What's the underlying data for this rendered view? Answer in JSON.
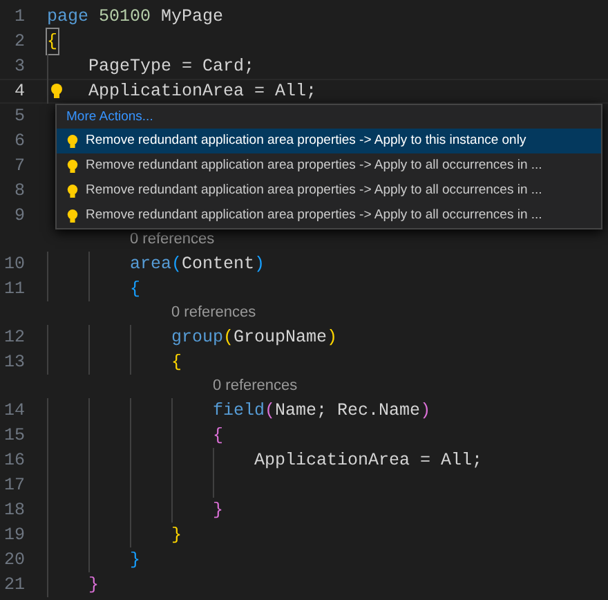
{
  "editor": {
    "lines": [
      {
        "kind": "code",
        "number": "1",
        "tokens": [
          {
            "kind": "keyword",
            "text": "page"
          },
          {
            "kind": "number",
            "text": " 50100"
          },
          {
            "kind": "plain",
            "text": " MyPage"
          }
        ]
      },
      {
        "kind": "code",
        "number": "2",
        "matched": true,
        "tokens": [
          {
            "kind": "bracket1",
            "text": "{"
          }
        ]
      },
      {
        "kind": "block",
        "children": [
          {
            "kind": "code",
            "number": "3",
            "tokens": [
              {
                "kind": "plain",
                "text": "PageType = Card;"
              }
            ]
          },
          {
            "kind": "code",
            "number": "4",
            "active": true,
            "lightbulb": true,
            "tokens": [
              {
                "kind": "plain",
                "text": "ApplicationArea = All;"
              }
            ]
          }
        ]
      },
      {
        "kind": "code",
        "number": "5"
      },
      {
        "kind": "code",
        "number": "6"
      },
      {
        "kind": "code",
        "number": "7"
      },
      {
        "kind": "code",
        "number": "8"
      },
      {
        "kind": "code",
        "number": "9"
      },
      {
        "kind": "block",
        "children": [
          {
            "kind": "block",
            "children": [
              {
                "kind": "codelens",
                "text": "0 references"
              },
              {
                "kind": "code",
                "number": "10",
                "tokens": [
                  {
                    "kind": "keyword",
                    "text": "area"
                  },
                  {
                    "kind": "bracket3",
                    "text": "("
                  },
                  {
                    "kind": "plain",
                    "text": "Content"
                  },
                  {
                    "kind": "bracket3",
                    "text": ")"
                  }
                ]
              },
              {
                "kind": "code",
                "number": "11",
                "tokens": [
                  {
                    "kind": "bracket3",
                    "text": "{"
                  }
                ]
              },
              {
                "kind": "block",
                "children": [
                  {
                    "kind": "codelens",
                    "text": "0 references"
                  },
                  {
                    "kind": "code",
                    "number": "12",
                    "tokens": [
                      {
                        "kind": "keyword",
                        "text": "group"
                      },
                      {
                        "kind": "bracket1",
                        "text": "("
                      },
                      {
                        "kind": "plain",
                        "text": "GroupName"
                      },
                      {
                        "kind": "bracket1",
                        "text": ")"
                      }
                    ]
                  },
                  {
                    "kind": "code",
                    "number": "13",
                    "tokens": [
                      {
                        "kind": "bracket1",
                        "text": "{"
                      }
                    ]
                  },
                  {
                    "kind": "block",
                    "children": [
                      {
                        "kind": "codelens",
                        "text": "0 references"
                      },
                      {
                        "kind": "code",
                        "number": "14",
                        "tokens": [
                          {
                            "kind": "keyword",
                            "text": "field"
                          },
                          {
                            "kind": "bracket2",
                            "text": "("
                          },
                          {
                            "kind": "plain",
                            "text": "Name; Rec.Name"
                          },
                          {
                            "kind": "bracket2",
                            "text": ")"
                          }
                        ]
                      },
                      {
                        "kind": "code",
                        "number": "15",
                        "tokens": [
                          {
                            "kind": "bracket2",
                            "text": "{"
                          }
                        ]
                      },
                      {
                        "kind": "block",
                        "children": [
                          {
                            "kind": "code",
                            "number": "16",
                            "tokens": [
                              {
                                "kind": "plain",
                                "text": "ApplicationArea = All;"
                              }
                            ]
                          },
                          {
                            "kind": "code",
                            "number": "17"
                          }
                        ]
                      },
                      {
                        "kind": "code",
                        "number": "18",
                        "tokens": [
                          {
                            "kind": "bracket2",
                            "text": "}"
                          }
                        ]
                      }
                    ]
                  },
                  {
                    "kind": "code",
                    "number": "19",
                    "tokens": [
                      {
                        "kind": "bracket1",
                        "text": "}"
                      }
                    ]
                  }
                ]
              },
              {
                "kind": "code",
                "number": "20",
                "tokens": [
                  {
                    "kind": "bracket3",
                    "text": "}"
                  }
                ]
              }
            ]
          },
          {
            "kind": "code",
            "number": "21",
            "tokens": [
              {
                "kind": "bracket2",
                "text": "}"
              }
            ]
          }
        ]
      }
    ]
  },
  "quick_fix_menu": {
    "title": "More Actions...",
    "items": [
      {
        "label": "Remove redundant application area properties -> Apply to this instance only",
        "selected": true
      },
      {
        "label": "Remove redundant application area properties -> Apply to all occurrences in ...",
        "selected": false
      },
      {
        "label": "Remove redundant application area properties -> Apply to all occurrences in ...",
        "selected": false
      },
      {
        "label": "Remove redundant application area properties -> Apply to all occurrences in ...",
        "selected": false
      }
    ]
  }
}
